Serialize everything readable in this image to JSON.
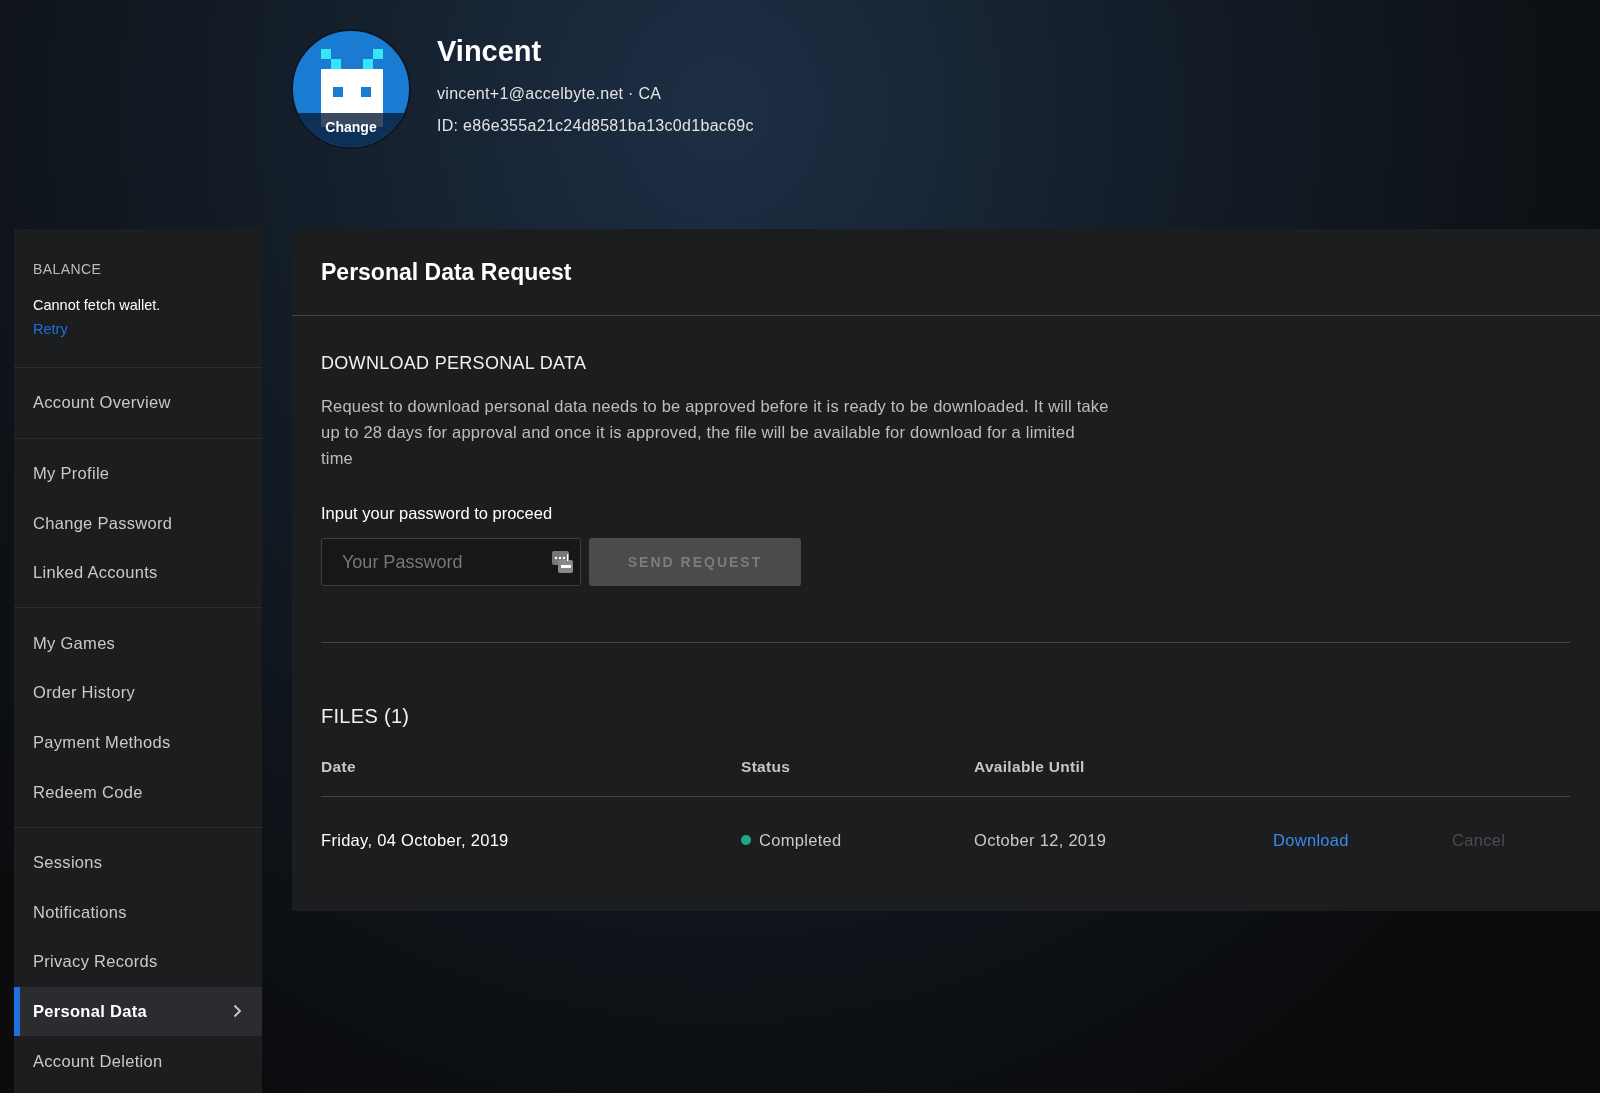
{
  "profile": {
    "name": "Vincent",
    "avatar_action": "Change",
    "email_line": "vincent+1@accelbyte.net · CA",
    "id_line": "ID: e86e355a21c24d8581ba13c0d1bac69c"
  },
  "sidebar": {
    "balance": {
      "label": "BALANCE",
      "message": "Cannot fetch wallet.",
      "retry": "Retry"
    },
    "groups": [
      {
        "items": [
          {
            "label": "Account Overview",
            "selected": false
          }
        ]
      },
      {
        "items": [
          {
            "label": "My Profile",
            "selected": false
          },
          {
            "label": "Change Password",
            "selected": false
          },
          {
            "label": "Linked Accounts",
            "selected": false
          }
        ]
      },
      {
        "items": [
          {
            "label": "My Games",
            "selected": false
          },
          {
            "label": "Order History",
            "selected": false
          },
          {
            "label": "Payment Methods",
            "selected": false
          },
          {
            "label": "Redeem Code",
            "selected": false
          }
        ]
      },
      {
        "items": [
          {
            "label": "Sessions",
            "selected": false
          },
          {
            "label": "Notifications",
            "selected": false
          },
          {
            "label": "Privacy Records",
            "selected": false
          },
          {
            "label": "Personal Data",
            "selected": true
          },
          {
            "label": "Account Deletion",
            "selected": false
          }
        ]
      }
    ]
  },
  "main": {
    "title": "Personal Data Request",
    "download": {
      "heading": "DOWNLOAD PERSONAL DATA",
      "description": "Request to download personal data needs to be approved before it is ready to be downloaded. It will take up to 28 days for approval and once it is approved, the file will be available for download for a limited time",
      "password_label": "Input your password to proceed",
      "password": {
        "placeholder": "Your Password"
      },
      "send_button": {
        "label": "SEND REQUEST",
        "disabled": true
      }
    },
    "files": {
      "heading": "FILES (1)",
      "columns": [
        "Date",
        "Status",
        "Available Until"
      ],
      "rows": [
        {
          "date": "Friday, 04 October, 2019",
          "status": "Completed",
          "color": "#1fa88a",
          "available_until": "October 12, 2019",
          "download": "Download",
          "cancel": {
            "label": "Cancel",
            "disabled": true
          }
        }
      ]
    }
  }
}
